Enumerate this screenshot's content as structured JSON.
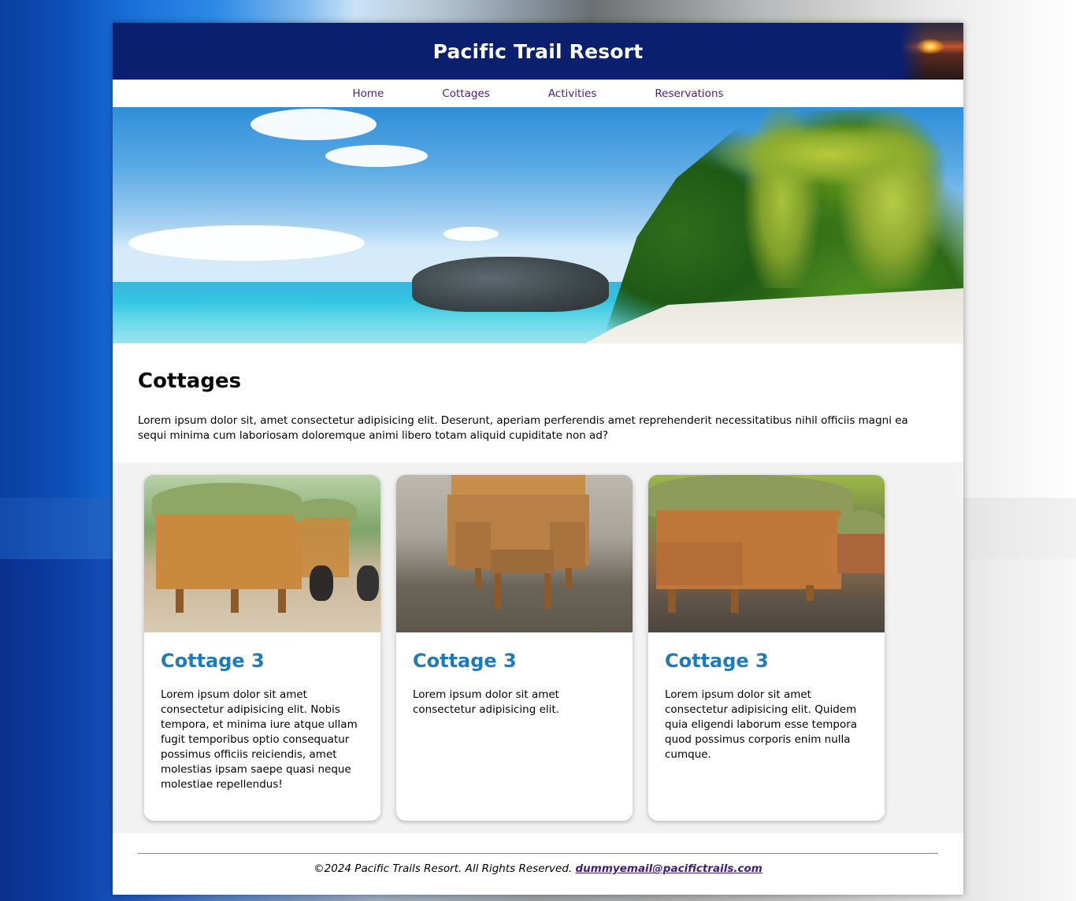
{
  "header": {
    "title": "Pacific Trail Resort"
  },
  "nav": {
    "items": [
      "Home",
      "Cottages",
      "Activities",
      "Reservations"
    ]
  },
  "main": {
    "heading": "Cottages",
    "intro": "Lorem ipsum dolor sit, amet consectetur adipisicing elit. Deserunt, aperiam perferendis amet reprehenderit necessitatibus nihil officiis magni ea sequi minima cum laboriosam doloremque animi libero totam aliquid cupiditate non ad?",
    "cards": [
      {
        "title": "Cottage 3",
        "text": "Lorem ipsum dolor sit amet consectetur adipisicing elit. Nobis tempora, et minima iure atque ullam fugit temporibus optio consequatur possimus officiis reiciendis, amet molestias ipsam saepe quasi neque molestiae repellendus!"
      },
      {
        "title": "Cottage 3",
        "text": "Lorem ipsum dolor sit amet consectetur adipisicing elit."
      },
      {
        "title": "Cottage 3",
        "text": "Lorem ipsum dolor sit amet consectetur adipisicing elit. Quidem quia eligendi laborum esse tempora quod possimus corporis enim nulla cumque."
      }
    ]
  },
  "footer": {
    "copyright": "©2024 Pacific Trails Resort. All Rights Reserved.",
    "email": "dummyemail@pacifictrails.com"
  },
  "colors": {
    "header_bg": "#0b1f6f",
    "nav_link": "#4b1d82",
    "card_title": "#1f7ab5",
    "cards_band": "#f2f2f2"
  }
}
